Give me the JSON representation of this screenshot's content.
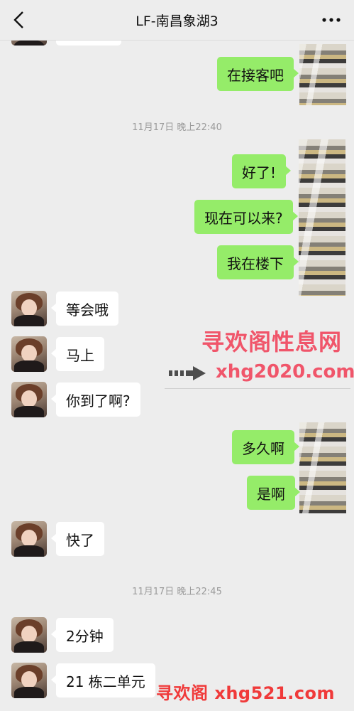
{
  "header": {
    "title": "LF-南昌象湖3"
  },
  "icons": {
    "back": "chevron-left-icon",
    "more": "more-dots-icon"
  },
  "colors": {
    "outgoing_bubble": "#95ec69",
    "incoming_bubble": "#ffffff",
    "background": "#ededed",
    "watermark": "#f0556a"
  },
  "messages": [
    {
      "dir": "out",
      "text": "在接客吧"
    },
    {
      "dir": "out",
      "text": "好了!"
    },
    {
      "dir": "out",
      "text": "现在可以来?"
    },
    {
      "dir": "out",
      "text": "我在楼下"
    },
    {
      "dir": "in",
      "text": "等会哦"
    },
    {
      "dir": "in",
      "text": "马上"
    },
    {
      "dir": "in",
      "text": "你到了啊?"
    },
    {
      "dir": "out",
      "text": "多久啊"
    },
    {
      "dir": "out",
      "text": "是啊"
    },
    {
      "dir": "in",
      "text": "快了"
    },
    {
      "dir": "in",
      "text": "2分钟"
    },
    {
      "dir": "in",
      "text": "21 栋二单元"
    }
  ],
  "timestamps": [
    "11月17日 晚上22:40",
    "11月17日 晚上22:45"
  ],
  "watermark": {
    "title": "寻欢阁性息网",
    "url": "xhg2020.com",
    "bottom": "寻欢阁 xhg521.com"
  }
}
